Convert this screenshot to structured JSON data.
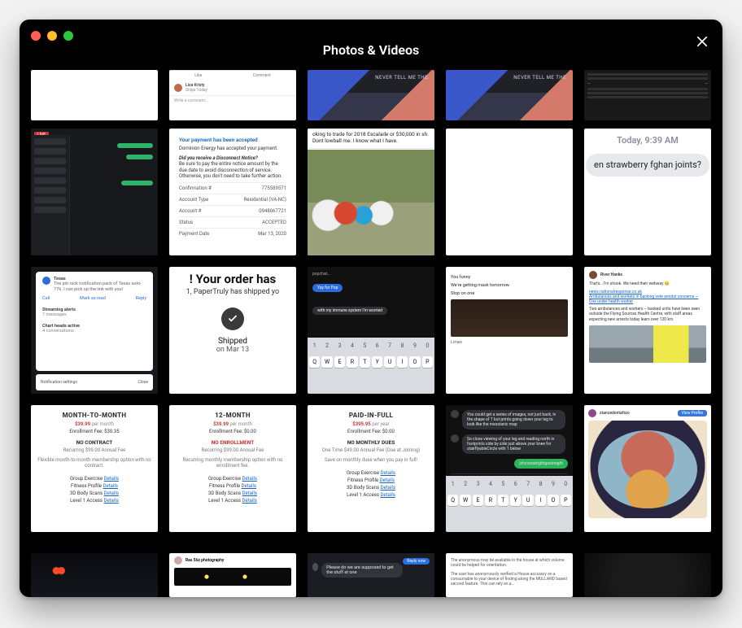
{
  "window": {
    "title": "Photos & Videos"
  },
  "row1": {
    "c2": {
      "like": "Like",
      "comment": "Comment",
      "name": "Lisa Kristy",
      "sub": "Ships Today",
      "write": "Write a comment…"
    },
    "c3": {
      "caption": "NEVER TELL ME THE"
    },
    "c4": {
      "caption": "NEVER TELL ME THE"
    }
  },
  "row2": {
    "c2": {
      "accepted": "Your payment has been accepted",
      "line1": "Dominion Energy has accepted your payment.",
      "notice_q": "Did you receive a Disconnect Notice?",
      "notice_body": "Be sure to pay the entire notice amount by the due date to avoid disconnection of service. Otherwise, you don't need to take further action.",
      "kv": [
        {
          "k": "Confirmation #",
          "v": "775589571"
        },
        {
          "k": "Account Type",
          "v": "Residential (VA-NC)"
        },
        {
          "k": "Account #",
          "v": "0948067721"
        },
        {
          "k": "Status",
          "v": "ACCEPTED"
        },
        {
          "k": "Payment Date",
          "v": "Mar 13, 2020"
        }
      ]
    },
    "c3": {
      "caption": "oking to trade for 2018 Escalade or $30,000 in sh. Dont lowball me. I know what I have."
    },
    "c5": {
      "timestamp": "Today, 9:39 AM",
      "message": "en strawberry fghan joints?"
    }
  },
  "row3": {
    "c1": {
      "sender": "Texas",
      "body": "The job rack notification pack of Texas auto-776. I can pick up the link with you!",
      "call": "Call",
      "mark": "Mark as read",
      "reply": "Reply",
      "section1": "Streaming alerts",
      "section1_sub": "7 messages",
      "section2": "Chart heads active",
      "section2_sub": "4 conversations",
      "foot_left": "Notification settings",
      "foot_right": "Close"
    },
    "c2": {
      "headline": "! Your order has",
      "subline": "1, PaperTruly has shipped yo",
      "status": "Shipped",
      "date": "on Mar 13"
    },
    "c3": {
      "thread": "popchat…",
      "b1": "Yay for Pop",
      "b2": "with my immune system I'm worried",
      "nums": [
        "1",
        "2",
        "3",
        "4",
        "5",
        "6",
        "7",
        "8",
        "9",
        "0"
      ],
      "keys": [
        "Q",
        "W",
        "E",
        "R",
        "T",
        "Y",
        "U",
        "I",
        "O",
        "P"
      ]
    },
    "c4": {
      "l1": "You funny",
      "l2": "We're getting mask tomorrow.",
      "l3": "Stop on one",
      "l4": "Lmao"
    },
    "c5": {
      "name": "River Hanks",
      "lead": "That's… I'm shook. We need their webway 😔",
      "link1": "news.nationalresponse.co.uk",
      "link2": "Ambulances and workers in backing vote amidst concerns — One under health worker",
      "para": "Two ambulances and workers – backed units have been seen outside the Flying Sources Health Centre, with staff areas expecting new arrests today learn over 120 km."
    }
  },
  "row4": {
    "plans": [
      {
        "name": "MONTH-TO-MONTH",
        "price": "$39.99",
        "per": "per month",
        "enroll": "Enrollment Fee: $30.35",
        "cap": "NO CONTRACT",
        "cap_sub": "Recurring $99.00 Annual Fee",
        "blurb": "Flexible month-to-month membership option with no contract.",
        "items": [
          "Group Exercise",
          "Fitness Profile",
          "3D Body Scans",
          "Level 1 Access"
        ],
        "details": "Details"
      },
      {
        "name": "12-MONTH",
        "price": "$39.99",
        "per": "per month",
        "enroll": "Enrollment Fee: $0.00",
        "cap": "NO ENROLLMENT",
        "cap_sub": "Recurring $99.00 Annual Fee",
        "blurb": "Recurring monthly membership option with no enrollment fee.",
        "items": [
          "Group Exercise",
          "Fitness Profile",
          "3D Body Scans",
          "Level 1 Access"
        ],
        "details": "Details"
      },
      {
        "name": "PAID-IN-FULL",
        "price": "$395.95",
        "per": "per year",
        "enroll": "Enrollment Fee: $0.00",
        "cap": "NO MONTHLY DUES",
        "cap_sub": "One Time $49.00 Annual Fee (Due at Joining)",
        "blurb": "Save on monthly dues when you pay in full!",
        "items": [
          "Group Exercise",
          "Fitness Profile",
          "3D Body Scans",
          "Level 1 Access"
        ],
        "details": "Details"
      }
    ],
    "c4": {
      "m1": "You could get a series of images, not just back, in the shape of T but prints going down your leg to look like the messianic map",
      "m2": "So close viewing of your leg and reading north in footprints side by side just above your knee for stairflyableCircle with 1 below",
      "m3": "jzhcszzatrightgostraight",
      "nums": [
        "1",
        "2",
        "3",
        "4",
        "5",
        "6",
        "7",
        "8",
        "9",
        "0"
      ],
      "keys": [
        "Q",
        "W",
        "E",
        "R",
        "T",
        "Y",
        "U",
        "I",
        "O",
        "P"
      ]
    },
    "c5": {
      "user": "stancedontattoo",
      "button": "View Profile"
    }
  },
  "row5": {
    "c2": {
      "name": "Ras 56z photography"
    },
    "c3": {
      "pill": "Reply now",
      "msg": "Please do we are supposed to get the stuff at one"
    },
    "c4": {
      "l1": "The anonymous may be available in the house at which volume could be helped for orientation.",
      "l2": "The user has anonymously verified a House accuracy on a consumable to your device of finding along the MULLAND based second feature. This can rely on a…"
    }
  }
}
